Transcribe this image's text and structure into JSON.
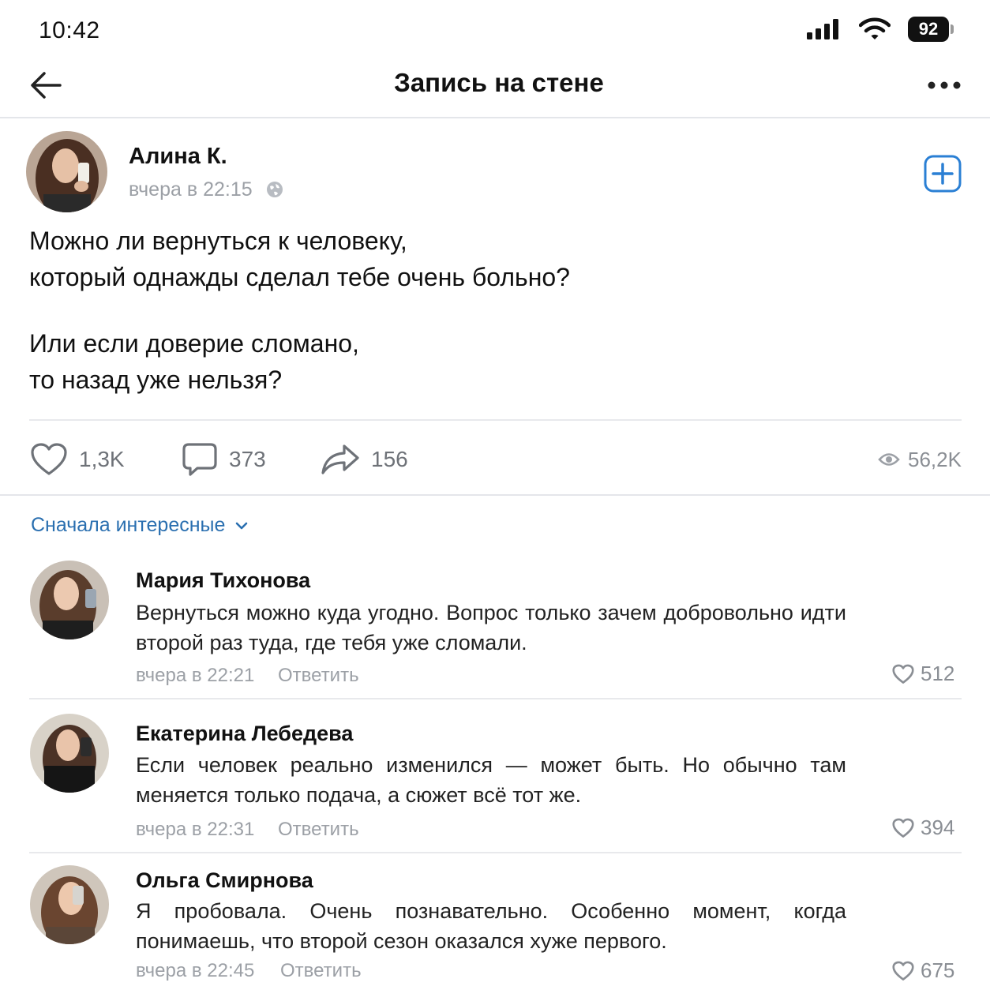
{
  "status_bar": {
    "time": "10:42",
    "battery": "92"
  },
  "nav": {
    "title": "Запись на стене",
    "back_icon": "arrow-left-icon",
    "more_icon": "more-horizontal-icon"
  },
  "post": {
    "author": "Алина К.",
    "meta": "вчера в 22:15",
    "text_lines": [
      "Можно ли вернуться к человеку,",
      "который однажды сделал тебе очень больно?",
      "Или если доверие сломано,",
      "то назад уже нельзя?"
    ],
    "likes": "1,3K",
    "comments": "373",
    "shares": "156",
    "views": "56,2K"
  },
  "sort_label": "Сначала интересные",
  "reply_label": "Ответить",
  "comments": [
    {
      "name": "Мария Тихонова",
      "text": "Вернуться можно куда угодно. Вопрос только зачем добровольно идти второй раз туда, где тебя уже сломали.",
      "time": "вчера в 22:21",
      "likes": "512"
    },
    {
      "name": "Екатерина Лебедева",
      "text": "Если человек реально изменился — может быть. Но обычно там меняется только подача, а сюжет всё тот же.",
      "time": "вчера в 22:31",
      "likes": "394"
    },
    {
      "name": "Ольга Смирнова",
      "text": "Я пробовала. Очень познавательно. Особенно момент, когда понимаешь, что второй сезон оказался хуже первого.",
      "time": "вчера в 22:45",
      "likes": "675"
    }
  ],
  "colors": {
    "accent": "#2a6fb0",
    "secondary_text": "#9ca0a6",
    "divider": "#e8e9ec"
  }
}
